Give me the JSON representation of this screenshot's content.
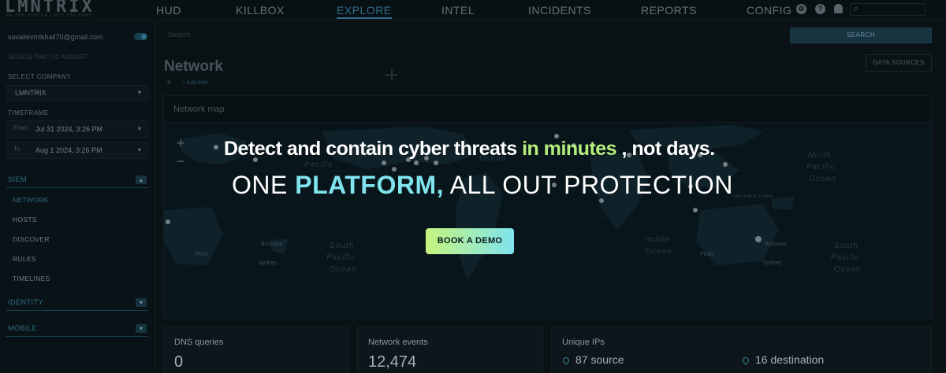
{
  "app": {
    "logo": "LMNTRIX",
    "tagline": "BE THE HUNTER | NOT THE PREY"
  },
  "nav": {
    "items": [
      {
        "label": "HUD"
      },
      {
        "label": "KILLBOX"
      },
      {
        "label": "EXPLORE"
      },
      {
        "label": "INTEL"
      },
      {
        "label": "INCIDENTS"
      },
      {
        "label": "REPORTS"
      },
      {
        "label": "CONFIG"
      }
    ],
    "active": "EXPLORE",
    "icons": [
      "settings-icon",
      "help-icon",
      "bell-icon",
      "search-icon"
    ]
  },
  "sidebar": {
    "user_email": "savalievmikhail70@gmail.com",
    "datetime": "16:33:15 THU | 01 AUGUST",
    "company_label": "SELECT COMPANY",
    "company_value": "LMNTRIX",
    "timeframe_label": "TIMEFRAME",
    "from_label": "From",
    "from_value": "Jul 31 2024, 3:26 PM",
    "to_label": "To",
    "to_value": "Aug 1 2024, 3:26 PM",
    "groups": [
      {
        "label": "SIEM",
        "expanded": true,
        "items": [
          "NETWORK",
          "HOSTS",
          "DISCOVER",
          "RULES",
          "TIMELINES"
        ]
      },
      {
        "label": "IDENTITY",
        "expanded": false
      },
      {
        "label": "MOBILE",
        "expanded": false
      }
    ],
    "active_item": "NETWORK"
  },
  "main": {
    "search_placeholder": "Search",
    "search_button": "SEARCH",
    "title": "Network",
    "data_sources_button": "DATA SOURCES",
    "add_filter": "+ Add filter",
    "map_title": "Network map",
    "zoom_in": "+",
    "zoom_out": "−",
    "map_labels": {
      "north_pacific_left": "Pacific",
      "north_pacific_right_1": "North",
      "north_pacific_right_2": "Pacific",
      "north_pacific_right_3": "Ocean",
      "ocean_mid": "Ocean",
      "south_pacific_1": "South",
      "south_pacific_2": "Pacific",
      "south_pacific_3": "Ocean",
      "indian_1": "Indian",
      "indian_2": "Ocean",
      "south_pacific_r1": "South",
      "south_pacific_r2": "Pacific",
      "south_pacific_r3": "Ocean",
      "perth_left": "Perth",
      "brisbane_left": "Brisbane",
      "sydney_left": "Sydney",
      "perth_right": "Perth",
      "brisbane_right": "Brisbane",
      "sydney_right": "Sydney",
      "papua_new_guinea": "PAPUA NEW GUINEA"
    }
  },
  "promo": {
    "line1_pre": "Detect and contain cyber threats ",
    "line1_accent": "in minutes",
    "line1_post": " , not days.",
    "line2_pre": "ONE  ",
    "line2_accent": "PLATFORM,",
    "line2_post": " ALL OUT PROTECTION",
    "cta": "BOOK A DEMO"
  },
  "stats": {
    "dns_label": "DNS queries",
    "dns_value": "0",
    "events_label": "Network events",
    "events_value": "12,474",
    "ips_label": "Unique IPs",
    "ips_source": "87 source",
    "ips_destination": "16 destination"
  },
  "colors": {
    "accent_blue": "#3b88a6",
    "promo_green": "#b7ef7e",
    "promo_cyan": "#7fe4ee"
  }
}
